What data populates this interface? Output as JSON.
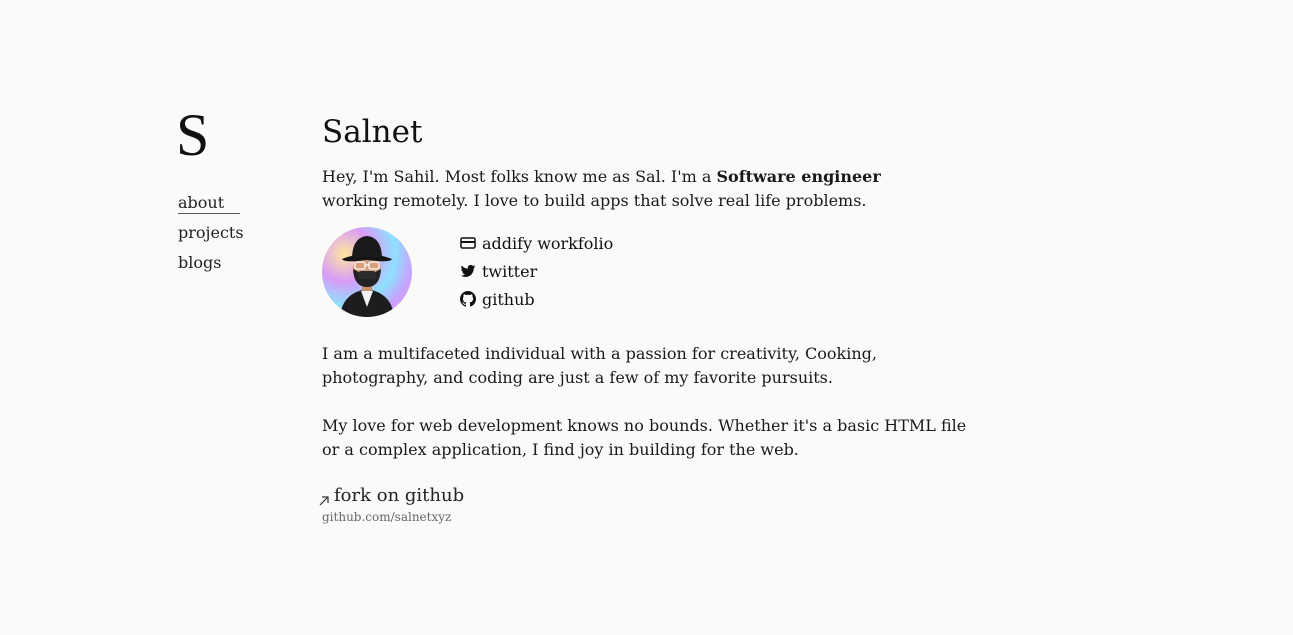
{
  "logo": {
    "letter": "S"
  },
  "nav": {
    "items": [
      {
        "label": "about"
      },
      {
        "label": "projects"
      },
      {
        "label": "blogs"
      }
    ]
  },
  "main": {
    "title": "Salnet",
    "intro_before": "Hey, I'm Sahil. Most folks know me as Sal. I'm a ",
    "intro_bold": "Software engineer",
    "intro_after": " working remotely. I love to build apps that solve real life problems.",
    "links": [
      {
        "label": "addify workfolio",
        "icon": "card-icon"
      },
      {
        "label": "twitter",
        "icon": "twitter-icon"
      },
      {
        "label": "github",
        "icon": "github-icon"
      }
    ],
    "paragraph_1": "I am a multifaceted individual with a passion for creativity, Cooking, photography, and coding are just a few of my favorite pursuits.",
    "paragraph_2": "My love for web development knows no bounds. Whether it's a basic HTML file or a complex application, I find joy in building for the web.",
    "fork": {
      "label": "fork on github",
      "url_text": "github.com/salnetxyz"
    }
  },
  "colors": {
    "background": "#fafaf8",
    "text": "#1a1a1a",
    "muted": "#666666"
  }
}
